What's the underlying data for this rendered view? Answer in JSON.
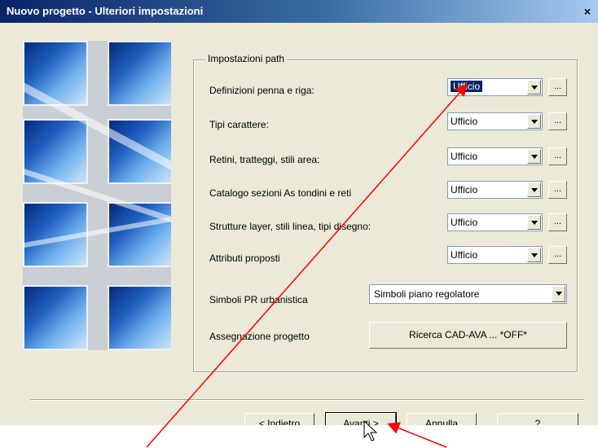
{
  "window": {
    "title": "Nuovo progetto - Ulteriori impostazioni",
    "close_label": "×"
  },
  "group": {
    "legend": "Impostazioni path"
  },
  "rows": [
    {
      "label": "Definizioni penna e riga:",
      "value": "Ufficio",
      "dots": "..."
    },
    {
      "label": "Tipi carattere:",
      "value": "Ufficio",
      "dots": "..."
    },
    {
      "label": "Retini, tratteggi, stili area:",
      "value": "Ufficio",
      "dots": "..."
    },
    {
      "label": "Catalogo sezioni As tondini e reti",
      "value": "Ufficio",
      "dots": "..."
    },
    {
      "label": "Strutture layer, stili linea, tipi disegno:",
      "value": "Ufficio",
      "dots": "..."
    },
    {
      "label": "Attributi proposti",
      "value": "Ufficio",
      "dots": "..."
    }
  ],
  "symbols": {
    "label": "Simboli PR urbanistica",
    "value": "Simboli piano regolatore"
  },
  "assign": {
    "label": "Assegnazione progetto",
    "button": "Ricerca CAD-AVA ... *OFF*"
  },
  "buttons": {
    "back": "< Indietro",
    "next": "Avanti >",
    "cancel": "Annulla",
    "help": "?"
  },
  "colors": {
    "annotation": "#ff0000",
    "titlebar": "#0a246a"
  }
}
